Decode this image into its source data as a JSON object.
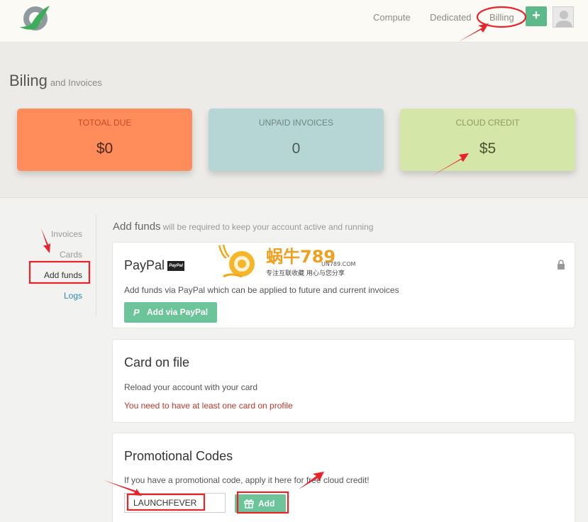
{
  "nav": {
    "items": [
      "Compute",
      "Dedicated",
      "Billing"
    ],
    "add_label": "+"
  },
  "page": {
    "title": "Biling",
    "subtitle": "and Invoices"
  },
  "summary": {
    "total_due": {
      "label": "TOTOAL DUE",
      "value": "$0",
      "color": "#ff8c5a"
    },
    "unpaid_invoices": {
      "label": "UNPAID INVOICES",
      "value": "0",
      "color": "#b6d5d5"
    },
    "cloud_credit": {
      "label": "CLOUD CREDIT",
      "value": "$5",
      "color": "#d5e6a9"
    }
  },
  "sidebar": {
    "items": [
      {
        "label": "Invoices",
        "active": false
      },
      {
        "label": "Cards",
        "active": false
      },
      {
        "label": "Add funds",
        "active": true
      },
      {
        "label": "Logs",
        "active": false
      }
    ]
  },
  "main": {
    "heading": "Add funds",
    "heading_note": "will be required to keep your account active and running"
  },
  "paypal": {
    "title": "PayPal",
    "badge": "PayPal",
    "description": "Add funds via PayPal which can be applied to future and current invoices",
    "button_label": "Add via PayPal",
    "button_icon": "P"
  },
  "card_on_file": {
    "title": "Card on file",
    "description": "Reload your account with your card",
    "warning": "You need to have at least one card on profile"
  },
  "promo": {
    "title": "Promotional Codes",
    "description": "If you have a promotional code, apply it here for free cloud credit!",
    "code_value": "LAUNCHFEVER",
    "button_label": "Add"
  },
  "watermark": {
    "brand": "蜗牛789",
    "domain": "UN789.COM",
    "slogan": "专注互联收藏  用心与您分享"
  },
  "colors": {
    "accent_green": "#6cc49b",
    "annotation_red": "#e8232a",
    "link_blue": "#2d8ab8"
  }
}
